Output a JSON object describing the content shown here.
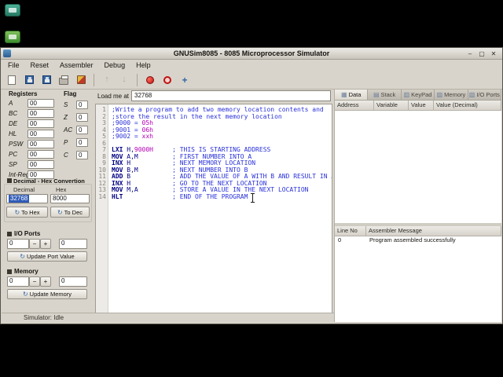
{
  "window": {
    "title": "GNUSim8085 - 8085 Microprocessor Simulator"
  },
  "menu": {
    "items": [
      "File",
      "Reset",
      "Assembler",
      "Debug",
      "Help"
    ]
  },
  "toolbar": {
    "buttons": [
      {
        "name": "new",
        "icon": "page-icon"
      },
      {
        "name": "save",
        "icon": "floppy-icon"
      },
      {
        "name": "save-as",
        "icon": "floppy-icon"
      },
      {
        "name": "print",
        "icon": "printer-icon"
      },
      {
        "name": "assemble",
        "icon": "assemble-icon"
      },
      {
        "separator": true
      },
      {
        "name": "step-over",
        "icon": "arrow-up-icon",
        "glyph": "↑",
        "disabled": true
      },
      {
        "name": "step-into",
        "icon": "arrow-down-icon",
        "glyph": "↓",
        "disabled": true
      },
      {
        "separator": true
      },
      {
        "name": "run",
        "icon": "record-icon"
      },
      {
        "name": "stop",
        "icon": "stop-icon"
      },
      {
        "name": "show-converter",
        "icon": "move-cross-icon",
        "glyph": "+"
      }
    ]
  },
  "registers": {
    "title": "Registers",
    "rows": [
      [
        "A",
        "00"
      ],
      [
        "BC",
        "00"
      ],
      [
        "DE",
        "00"
      ],
      [
        "HL",
        "00"
      ],
      [
        "PSW",
        "00"
      ],
      [
        "PC",
        "00"
      ],
      [
        "SP",
        "00"
      ],
      [
        "Int-Reg",
        "00"
      ]
    ]
  },
  "flags": {
    "title": "Flag",
    "rows": [
      [
        "S",
        "0"
      ],
      [
        "Z",
        "0"
      ],
      [
        "AC",
        "0"
      ],
      [
        "P",
        "0"
      ],
      [
        "C",
        "0"
      ]
    ]
  },
  "converter": {
    "title": "Decimal - Hex Convertion",
    "decimal_label": "Decimal",
    "hex_label": "Hex",
    "decimal_value": "32768",
    "hex_value": "8000",
    "to_hex": "To Hex",
    "to_dec": "To Dec"
  },
  "io_ports": {
    "title": "I/O Ports",
    "value1": "0",
    "value2": "0",
    "update": "Update Port Value"
  },
  "memory": {
    "title": "Memory",
    "value1": "0",
    "value2": "0",
    "update": "Update Memory"
  },
  "spin": {
    "minus": "−",
    "plus": "+"
  },
  "status": {
    "text": "Simulator: Idle"
  },
  "editor": {
    "load_label": "Load me at",
    "load_value": "32768",
    "lines": [
      {
        "n": "1",
        "segs": [
          [
            "cmt",
            ";Write a program to add two memory location contents and"
          ]
        ]
      },
      {
        "n": "2",
        "segs": [
          [
            "cmt",
            ";store the result in the next memory location"
          ]
        ]
      },
      {
        "n": "3",
        "segs": [
          [
            "cmt",
            ";9000 = "
          ],
          [
            "num",
            "05h"
          ]
        ]
      },
      {
        "n": "4",
        "segs": [
          [
            "cmt",
            ";9001 = "
          ],
          [
            "num",
            "06h"
          ]
        ]
      },
      {
        "n": "5",
        "segs": [
          [
            "cmt",
            ";9002 = "
          ],
          [
            "num",
            "xxh"
          ]
        ]
      },
      {
        "n": "6",
        "segs": []
      },
      {
        "n": "7",
        "segs": [
          [
            "mn",
            "LXI"
          ],
          [
            "op",
            " H,"
          ],
          [
            "num",
            "9000H"
          ],
          [
            "sp",
            "     "
          ],
          [
            "cmt",
            "; THIS IS STARTING ADDRESS"
          ]
        ]
      },
      {
        "n": "8",
        "segs": [
          [
            "mn",
            "MOV"
          ],
          [
            "op",
            " A,M"
          ],
          [
            "sp",
            "         "
          ],
          [
            "cmt",
            "; FIRST NUMBER INTO A"
          ]
        ]
      },
      {
        "n": "9",
        "segs": [
          [
            "mn",
            "INX"
          ],
          [
            "op",
            " H"
          ],
          [
            "sp",
            "           "
          ],
          [
            "cmt",
            "; NEXT MEMORY LOCATION"
          ]
        ]
      },
      {
        "n": "10",
        "segs": [
          [
            "mn",
            "MOV"
          ],
          [
            "op",
            " B,M"
          ],
          [
            "sp",
            "         "
          ],
          [
            "cmt",
            "; NEXT NUMBER INTO B"
          ]
        ]
      },
      {
        "n": "11",
        "segs": [
          [
            "mn",
            "ADD"
          ],
          [
            "op",
            " B"
          ],
          [
            "sp",
            "           "
          ],
          [
            "cmt",
            "; ADD THE VALUE OF A WITH B AND RESULT IN A"
          ]
        ]
      },
      {
        "n": "12",
        "segs": [
          [
            "mn",
            "INX"
          ],
          [
            "op",
            " H"
          ],
          [
            "sp",
            "           "
          ],
          [
            "cmt",
            "; GO TO THE NEXT LOCATION"
          ]
        ]
      },
      {
        "n": "13",
        "segs": [
          [
            "mn",
            "MOV"
          ],
          [
            "op",
            " M,A"
          ],
          [
            "sp",
            "         "
          ],
          [
            "cmt",
            "; STORE A VALUE IN THE NEXT LOCATION"
          ]
        ]
      },
      {
        "n": "14",
        "segs": [
          [
            "mn",
            "HLT"
          ],
          [
            "sp",
            "             "
          ],
          [
            "cmt",
            "; END OF THE PROGRAM"
          ]
        ]
      }
    ]
  },
  "right_panel": {
    "tabs": [
      {
        "label": "Data",
        "icon": "data-grid-icon",
        "glyph": "▦",
        "active": true
      },
      {
        "label": "Stack",
        "icon": "stack-icon",
        "glyph": "▤",
        "active": false
      },
      {
        "label": "KeyPad",
        "icon": "keypad-icon",
        "glyph": "▥",
        "active": false
      },
      {
        "label": "Memory",
        "icon": "memory-icon",
        "glyph": "▨",
        "active": false
      },
      {
        "label": "I/O Ports",
        "icon": "io-ports-icon",
        "glyph": "▧",
        "active": false
      }
    ],
    "data_table": {
      "headers": [
        "Address",
        "Variable",
        "Value",
        "Value (Decimal)"
      ],
      "rows": []
    },
    "message_table": {
      "headers": [
        "Line No",
        "Assembler Message"
      ],
      "rows": [
        [
          "0",
          "Program assembled successfully"
        ]
      ]
    }
  },
  "colors": {
    "accent": "#3465a4",
    "selection": "#2f5bb7",
    "comment": "#2931d8",
    "mnemonic": "#000082",
    "number": "#b400b4"
  }
}
